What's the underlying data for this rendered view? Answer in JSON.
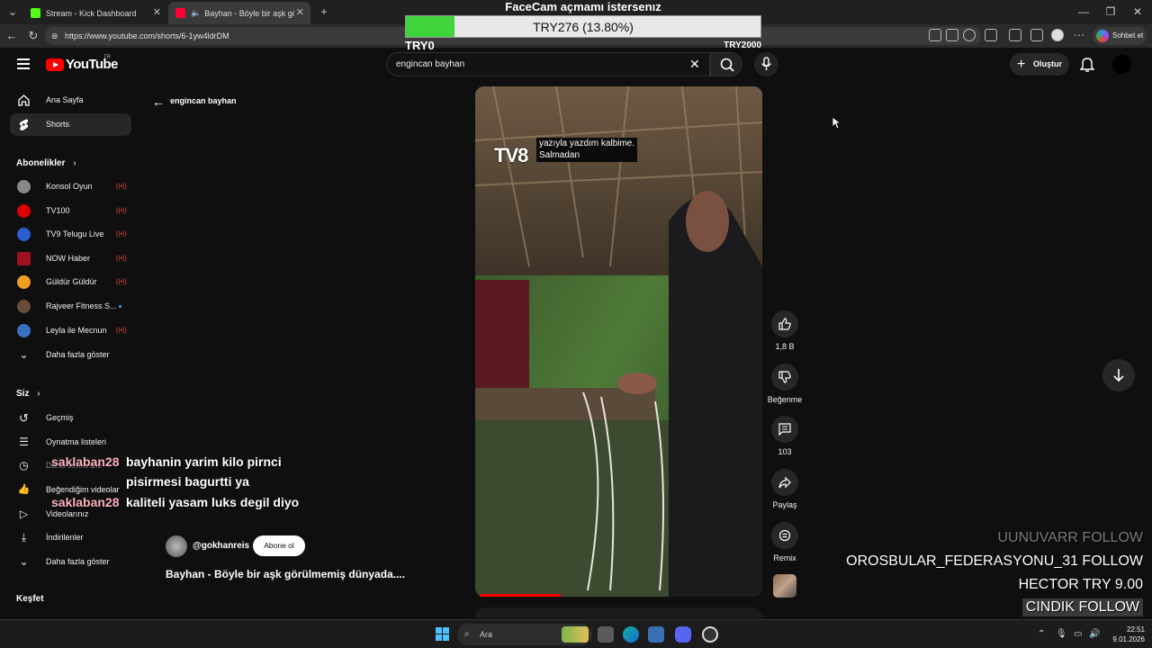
{
  "browser": {
    "tabs": [
      {
        "label": "Stream - Kick Dashboard",
        "favicon_color": "#53fc18"
      },
      {
        "label": "Bayhan - Böyle bir aşk görülm",
        "favicon_color": "#ff0033"
      }
    ],
    "url": "https://www.youtube.com/shorts/6-1yw4ldrDM",
    "copilot_label": "Sohbet et"
  },
  "goal_overlay": {
    "title": "FaceCam açmamı istersenız",
    "progress_text": "TRY276 (13.80%)",
    "progress": 0.138,
    "min_label": "TRY0",
    "max_label": "TRY2000",
    "fill_color": "#3fd43c"
  },
  "header": {
    "logo_text": "YouTube",
    "region": "TR",
    "search_value": "engincan bayhan",
    "create_label": "Oluştur"
  },
  "sidebar": {
    "home": "Ana Sayfa",
    "shorts": "Shorts",
    "subs_heading": "Abonelikler",
    "subscriptions": [
      {
        "name": "Konsol Oyun",
        "status": "live"
      },
      {
        "name": "TV100",
        "status": "live"
      },
      {
        "name": "TV9 Telugu Live",
        "status": "live"
      },
      {
        "name": "NOW Haber",
        "status": "live"
      },
      {
        "name": "Güldür Güldür",
        "status": "live"
      },
      {
        "name": "Rajveer Fitness S...",
        "status": "new"
      },
      {
        "name": "Leyla ile Mecnun",
        "status": "live"
      }
    ],
    "show_more": "Daha fazla göster",
    "you_heading": "Siz",
    "you_items": [
      "Geçmiş",
      "Oynatma listeleri",
      "Daha sonra izle",
      "Beğendiğim videolar",
      "Videolarınız",
      "İndirilenler",
      "Daha fazla göster"
    ],
    "explore_heading": "Keşfet",
    "live_icon_text": "((•))"
  },
  "main": {
    "back_label": "engincan bayhan",
    "channel": "@gokhanreis",
    "subscribe_label": "Abone ol",
    "video_title": "Bayhan - Böyle bir aşk görülmemiş dünyada....",
    "caption_line1": "yazıyla yazdım kalbime.",
    "caption_line2": "Salmadan",
    "logo_text": "TV8",
    "actions": {
      "like_count": "1,8 B",
      "dislike_label": "Beğenme",
      "comment_count": "103",
      "share_label": "Paylaş",
      "remix_label": "Remix"
    }
  },
  "chat": [
    {
      "user": "saklaban28",
      "message": "bayhanin yarim kilo pirnci"
    },
    {
      "user": "",
      "message": "pisirmesi bagurtti ya"
    },
    {
      "user": "saklaban28",
      "message": "kaliteli yasam luks degil diyo"
    }
  ],
  "events": [
    "UUNUVARR  FOLLOW",
    "OROSBULAR_FEDERASYONU_31  FOLLOW",
    "HECTOR  TRY 9.00",
    "CINDIK  FOLLOW"
  ],
  "taskbar": {
    "search_placeholder": "Ara",
    "time": "22:51",
    "date": "9.01.2026"
  }
}
